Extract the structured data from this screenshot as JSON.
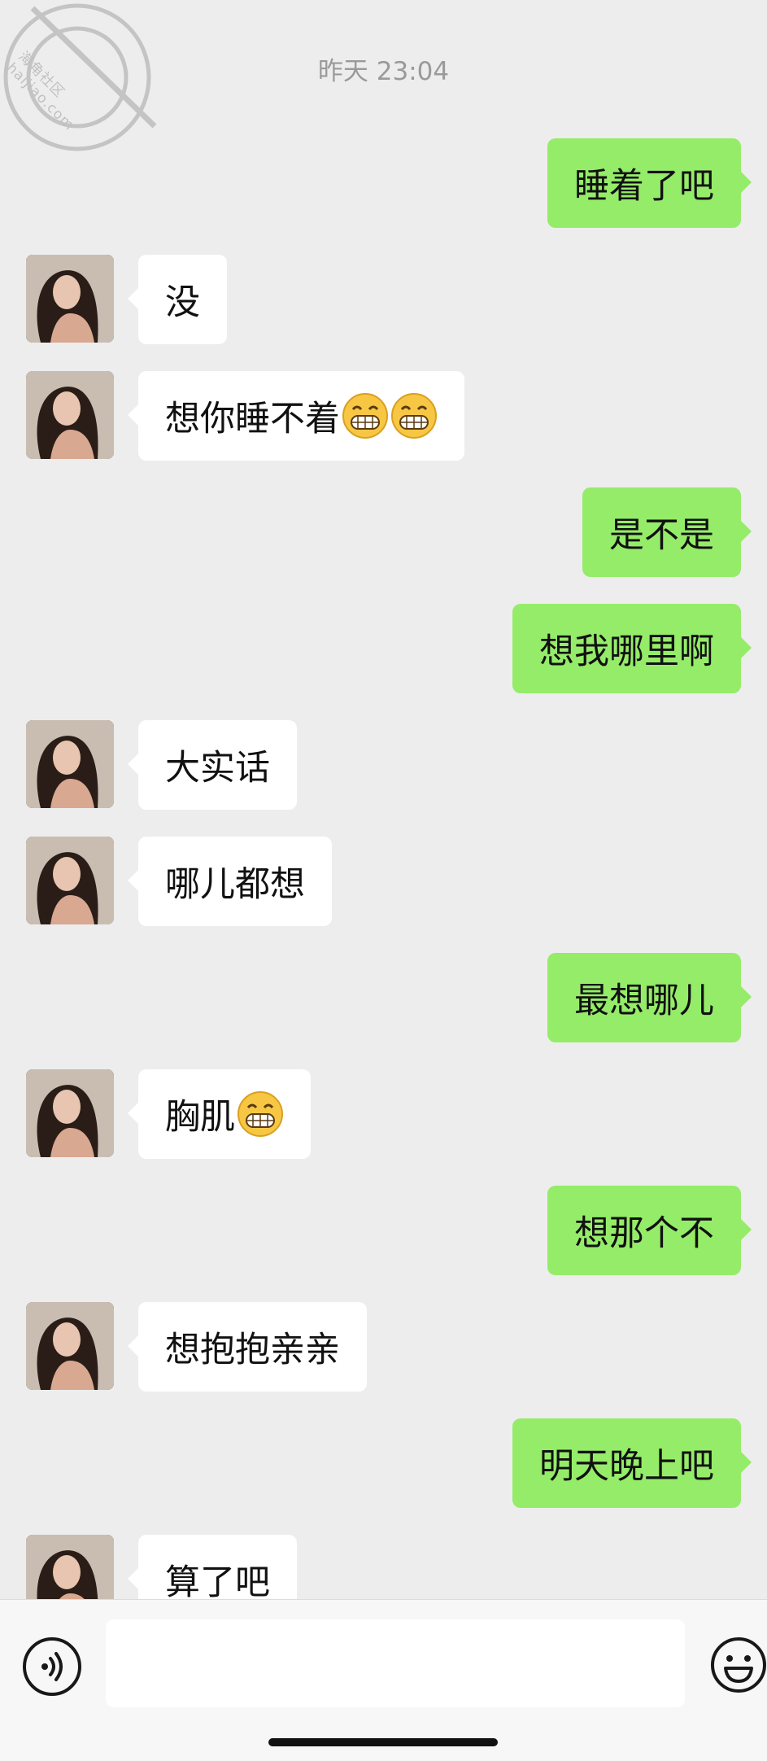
{
  "watermark": {
    "text": "海角社区 haijiao.com"
  },
  "timestamp": "昨天 23:04",
  "messages": [
    {
      "side": "out",
      "text": "睡着了吧"
    },
    {
      "side": "in",
      "text": "没"
    },
    {
      "side": "in",
      "text": "想你睡不着",
      "emoji_count": 2,
      "emoji": "grinning-face-emoji"
    },
    {
      "side": "out",
      "text": "是不是"
    },
    {
      "side": "out",
      "text": "想我哪里啊"
    },
    {
      "side": "in",
      "text": "大实话"
    },
    {
      "side": "in",
      "text": "哪儿都想"
    },
    {
      "side": "out",
      "text": "最想哪儿"
    },
    {
      "side": "in",
      "text": "胸肌",
      "emoji_count": 1,
      "emoji": "grinning-face-emoji"
    },
    {
      "side": "out",
      "text": "想那个不"
    },
    {
      "side": "in",
      "text": "想抱抱亲亲"
    },
    {
      "side": "out",
      "text": "明天晚上吧"
    },
    {
      "side": "in",
      "text": "算了吧"
    }
  ],
  "input_bar": {
    "voice_icon": "voice-icon",
    "input_value": "",
    "emoji_icon": "emoji-icon"
  },
  "colors": {
    "background": "#ededed",
    "outgoing_bubble": "#95ec69",
    "incoming_bubble": "#ffffff",
    "timestamp_text": "#9a9a9a"
  }
}
